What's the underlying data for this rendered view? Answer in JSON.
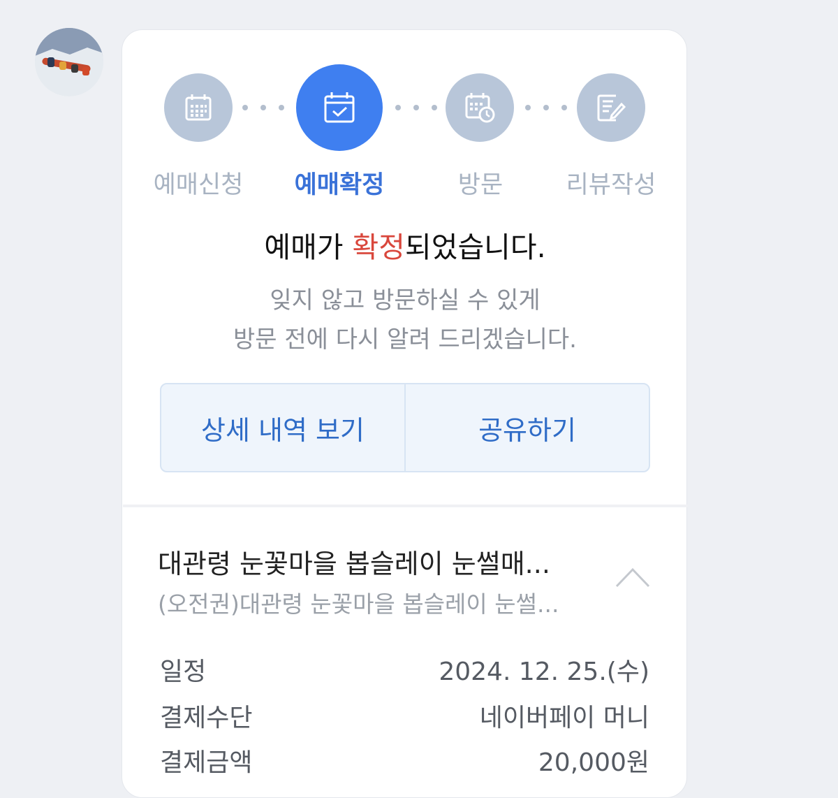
{
  "steps": [
    {
      "label": "예매신청",
      "icon": "calendar-grid-icon",
      "active": false
    },
    {
      "label": "예매확정",
      "icon": "calendar-check-icon",
      "active": true
    },
    {
      "label": "방문",
      "icon": "calendar-clock-icon",
      "active": false
    },
    {
      "label": "리뷰작성",
      "icon": "edit-note-icon",
      "active": false
    }
  ],
  "headline": {
    "prefix": "예매가 ",
    "accent": "확정",
    "suffix": "되었습니다."
  },
  "message": {
    "line1": "잊지 않고 방문하실 수 있게",
    "line2": "방문 전에 다시 알려 드리겠습니다."
  },
  "buttons": {
    "details": "상세 내역 보기",
    "share": "공유하기"
  },
  "booking": {
    "title": "대관령 눈꽃마을 봅슬레이 눈썰매...",
    "subtitle": "(오전권)대관령 눈꽃마을 봅슬레이 눈썰...",
    "rows": [
      {
        "label": "일정",
        "value": "2024. 12. 25.(수)"
      },
      {
        "label": "결제수단",
        "value": "네이버페이 머니"
      },
      {
        "label": "결제금액",
        "value": "20,000원"
      }
    ]
  },
  "colors": {
    "active": "#3f7ff0",
    "inactive": "#b8c6d9",
    "accent": "#d9473c",
    "button_text": "#2f6cc7"
  }
}
